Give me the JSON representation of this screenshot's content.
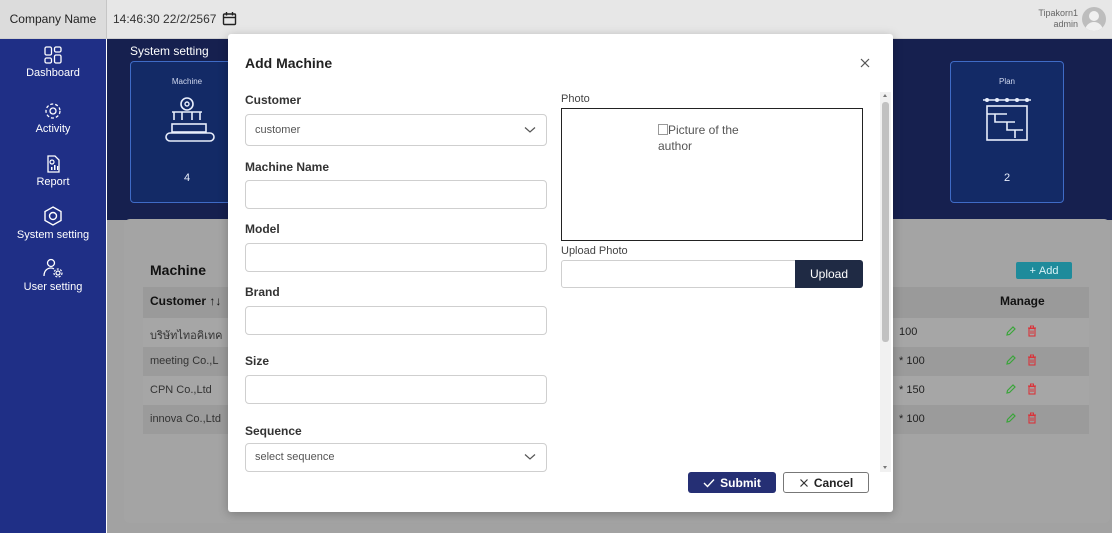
{
  "topbar": {
    "company_name": "Company Name",
    "datetime": "14:46:30 22/2/2567",
    "user_name": "Tipakorn1",
    "user_role": "admin"
  },
  "sidebar": {
    "items": [
      {
        "label": "Dashboard",
        "icon": "dashboard-icon"
      },
      {
        "label": "Activity",
        "icon": "activity-icon"
      },
      {
        "label": "Report",
        "icon": "report-icon"
      },
      {
        "label": "System setting",
        "icon": "system-setting-icon"
      },
      {
        "label": "User setting",
        "icon": "user-setting-icon"
      }
    ]
  },
  "main": {
    "section_title": "System setting",
    "cards": [
      {
        "title": "Machine",
        "count": "4",
        "icon": "machine-icon"
      },
      {
        "title": "Plan",
        "count": "2",
        "icon": "plan-icon"
      }
    ],
    "table": {
      "title": "Machine",
      "add_label": "Add",
      "headers": {
        "customer": "Customer",
        "manage": "Manage"
      },
      "rows": [
        {
          "customer": "บริษัทไทอคิเทค",
          "size": "100"
        },
        {
          "customer": "meeting Co.,L",
          "size": "* 100"
        },
        {
          "customer": "CPN Co.,Ltd",
          "size": "* 150"
        },
        {
          "customer": "innova Co.,Ltd",
          "size": "* 100"
        }
      ]
    }
  },
  "modal": {
    "title": "Add Machine",
    "fields": {
      "customer_label": "Customer",
      "customer_value": "customer",
      "machine_name_label": "Machine Name",
      "model_label": "Model",
      "brand_label": "Brand",
      "size_label": "Size",
      "sequence_label": "Sequence",
      "sequence_value": "select sequence"
    },
    "photo_label": "Photo",
    "photo_alt": "Picture of the author",
    "upload_label": "Upload Photo",
    "upload_button": "Upload",
    "submit_label": "Submit",
    "cancel_label": "Cancel"
  },
  "colors": {
    "sidebar": "#1f2f86",
    "primary": "#252f74",
    "add_button": "#1f8b9b",
    "delete": "#d9343b",
    "edit": "#3aa53a"
  }
}
